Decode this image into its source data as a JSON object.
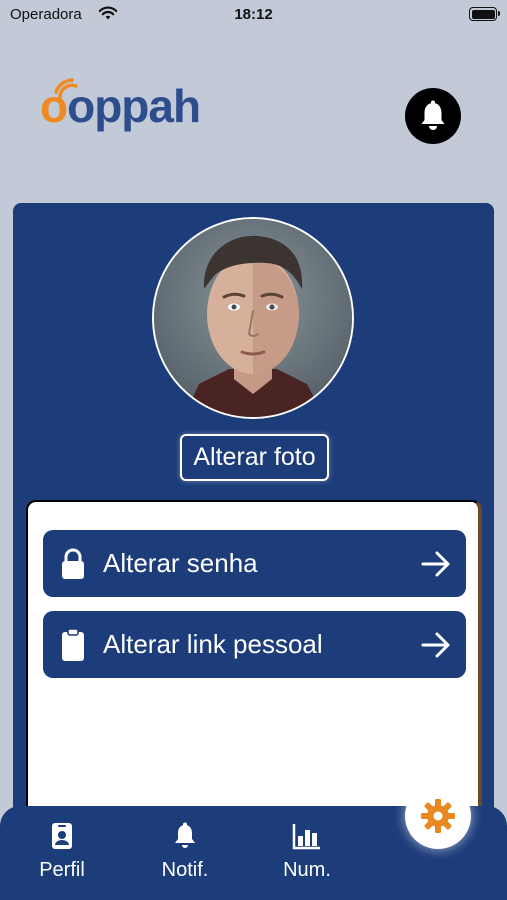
{
  "status_bar": {
    "carrier": "Operadora",
    "time": "18:12"
  },
  "header": {
    "logo_o": "o",
    "logo_rest": "oppah",
    "notification_icon": "bell-icon"
  },
  "profile": {
    "avatar_icon": "avatar",
    "change_photo_label": "Alterar foto"
  },
  "menu": [
    {
      "icon": "lock-icon",
      "label": "Alterar senha",
      "arrow": "arrow-right-icon"
    },
    {
      "icon": "clipboard-icon",
      "label": "Alterar link pessoal",
      "arrow": "arrow-right-icon"
    }
  ],
  "tabs": [
    {
      "icon": "id-card-icon",
      "label": "Perfil"
    },
    {
      "icon": "bell-icon",
      "label": "Notif."
    },
    {
      "icon": "bar-chart-icon",
      "label": "Num."
    }
  ],
  "fab": {
    "icon": "gear-icon"
  },
  "colors": {
    "background": "#c2c9d7",
    "primary": "#1c3c7a",
    "logo_orange": "#ef8a22",
    "logo_blue": "#2d4d8c",
    "gear_orange": "#e8891f"
  }
}
